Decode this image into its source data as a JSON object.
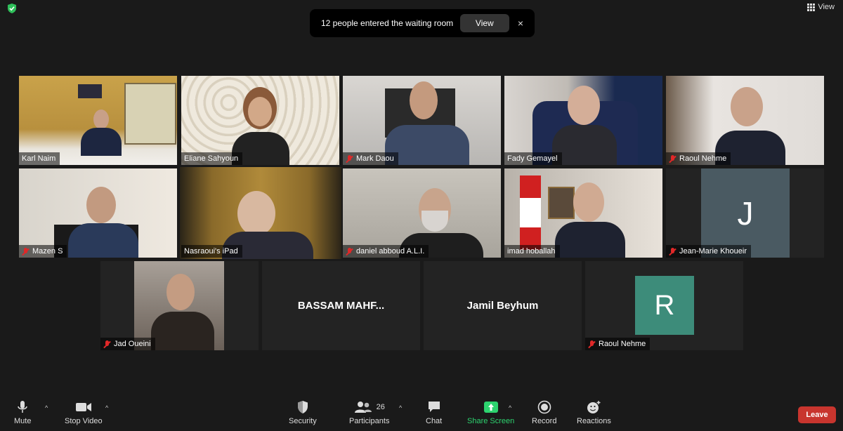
{
  "top": {
    "view_label": "View"
  },
  "notice": {
    "text": "12 people entered the waiting room",
    "button": "View",
    "close": "×"
  },
  "tiles": [
    {
      "name": "Karl Naim",
      "muted": false
    },
    {
      "name": "Eliane Sahyoun",
      "muted": false
    },
    {
      "name": "Mark Daou",
      "muted": true
    },
    {
      "name": "Fady Gemayel",
      "muted": false
    },
    {
      "name": "Raoul Nehme",
      "muted": true
    },
    {
      "name": "Mazen S",
      "muted": true
    },
    {
      "name": "Nasraoui's iPad",
      "muted": false,
      "active": true
    },
    {
      "name": "daniel abboud A.L.I.",
      "muted": true
    },
    {
      "name": "imad hoballah",
      "muted": false
    },
    {
      "name": "Jean-Marie Khoueir",
      "muted": true,
      "avatar_letter": "J"
    },
    {
      "name": "Jad Oueini",
      "muted": true
    },
    {
      "display_name": "BASSAM  MAHF..."
    },
    {
      "display_name": "Jamil Beyhum"
    },
    {
      "name": "Raoul Nehme",
      "muted": true,
      "avatar_letter": "R"
    }
  ],
  "toolbar": {
    "mute": "Mute",
    "stop_video": "Stop Video",
    "security": "Security",
    "participants": "Participants",
    "participants_count": "26",
    "chat": "Chat",
    "share_screen": "Share Screen",
    "record": "Record",
    "reactions": "Reactions",
    "leave": "Leave"
  },
  "colors": {
    "share_green": "#2dd36f",
    "leave_red": "#c8352e",
    "active_speaker": "#d4e85a",
    "avatar_j": "#4a5a62",
    "avatar_r": "#3d8c7a"
  }
}
